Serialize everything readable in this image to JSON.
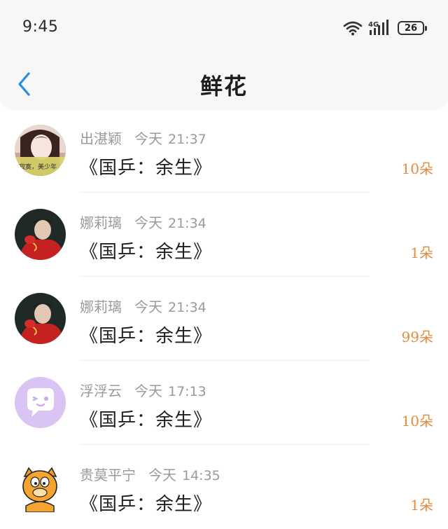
{
  "status_bar": {
    "time": "9:45",
    "network": "4G",
    "battery": "26"
  },
  "header": {
    "title": "鲜花",
    "back_icon": "chevron-left-icon"
  },
  "colors": {
    "accent": "#2a8cdc",
    "count": "#e58a3c",
    "meta": "#9a9a9a"
  },
  "gifts": [
    {
      "name": "出湛颖",
      "date": "今天",
      "time": "21:37",
      "work": "《国乒：余生》",
      "count": "10朵",
      "avatar": "girl-avatar-icon",
      "avatar_caption": "寂寞，美少年"
    },
    {
      "name": "娜莉璃",
      "date": "今天",
      "time": "21:34",
      "work": "《国乒：余生》",
      "count": "1朵",
      "avatar": "boy-red-avatar-icon"
    },
    {
      "name": "娜莉璃",
      "date": "今天",
      "time": "21:34",
      "work": "《国乒：余生》",
      "count": "99朵",
      "avatar": "boy-red-avatar-icon"
    },
    {
      "name": "浮浮云",
      "date": "今天",
      "time": "17:13",
      "work": "《国乒：余生》",
      "count": "10朵",
      "avatar": "chat-bubble-avatar-icon"
    },
    {
      "name": "贵莫平宁",
      "date": "今天",
      "time": "14:35",
      "work": "《国乒：余生》",
      "count": "1朵",
      "avatar": "garfield-avatar-icon"
    }
  ]
}
